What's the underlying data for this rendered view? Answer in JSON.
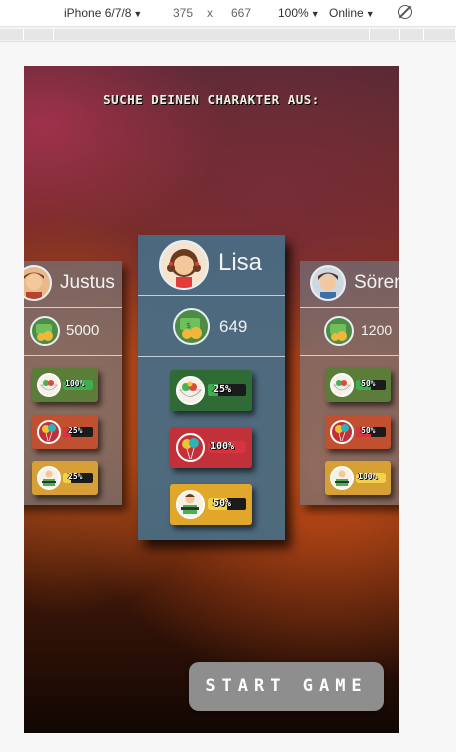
{
  "devtools": {
    "device": "iPhone 6/7/8",
    "width": "375",
    "times": "x",
    "height": "667",
    "zoom": "100%",
    "network": "Online"
  },
  "game": {
    "title": "SUCHE DEINEN CHARAKTER AUS:",
    "start_label": "START GAME",
    "characters": [
      {
        "name": "Justus",
        "money": "5000",
        "stats": [
          {
            "icon": "salad-bowl-icon",
            "label": "100%",
            "level": 1.0
          },
          {
            "icon": "balloons-icon",
            "label": "25%",
            "level": 0.25
          },
          {
            "icon": "work-icon",
            "label": "25%",
            "level": 0.25
          }
        ]
      },
      {
        "name": "Lisa",
        "money": "649",
        "stats": [
          {
            "icon": "salad-bowl-icon",
            "label": "25%",
            "level": 0.25
          },
          {
            "icon": "balloons-icon",
            "label": "100%",
            "level": 1.0
          },
          {
            "icon": "work-icon",
            "label": "50%",
            "level": 0.5
          }
        ]
      },
      {
        "name": "Sören",
        "money": "1200",
        "stats": [
          {
            "icon": "salad-bowl-icon",
            "label": "50%",
            "level": 0.5
          },
          {
            "icon": "balloons-icon",
            "label": "50%",
            "level": 0.5
          },
          {
            "icon": "work-icon",
            "label": "100%",
            "level": 1.0
          }
        ]
      }
    ]
  },
  "colors": {
    "food": "#2f6b35",
    "fun": "#c2303a",
    "work": "#e0a72a",
    "fill_food": "#3fae4e",
    "fill_fun": "#d8343f",
    "fill_work": "#f2d24a",
    "start_button": "#8e8e8e"
  }
}
